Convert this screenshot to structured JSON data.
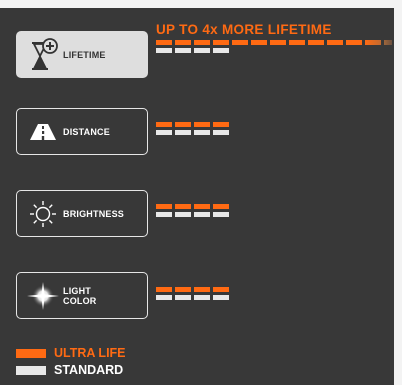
{
  "headline": "UP TO 4x MORE LIFETIME",
  "features": [
    {
      "label": "LIFETIME",
      "icon": "hourglass-plus-icon",
      "ultra_segments": 12.5,
      "standard_segments": 4
    },
    {
      "label": "DISTANCE",
      "icon": "road-icon",
      "ultra_segments": 4,
      "standard_segments": 4
    },
    {
      "label": "BRIGHTNESS",
      "icon": "sun-icon",
      "ultra_segments": 4,
      "standard_segments": 4
    },
    {
      "label_line1": "LIGHT",
      "label_line2": "COLOR",
      "icon": "light-sparkle-icon",
      "ultra_segments": 4,
      "standard_segments": 4
    }
  ],
  "legend": {
    "ultra": "ULTRA LIFE",
    "standard": "STANDARD"
  },
  "colors": {
    "ultra": "#ff6a13",
    "standard": "#e8e8e8",
    "panel": "#383838"
  }
}
